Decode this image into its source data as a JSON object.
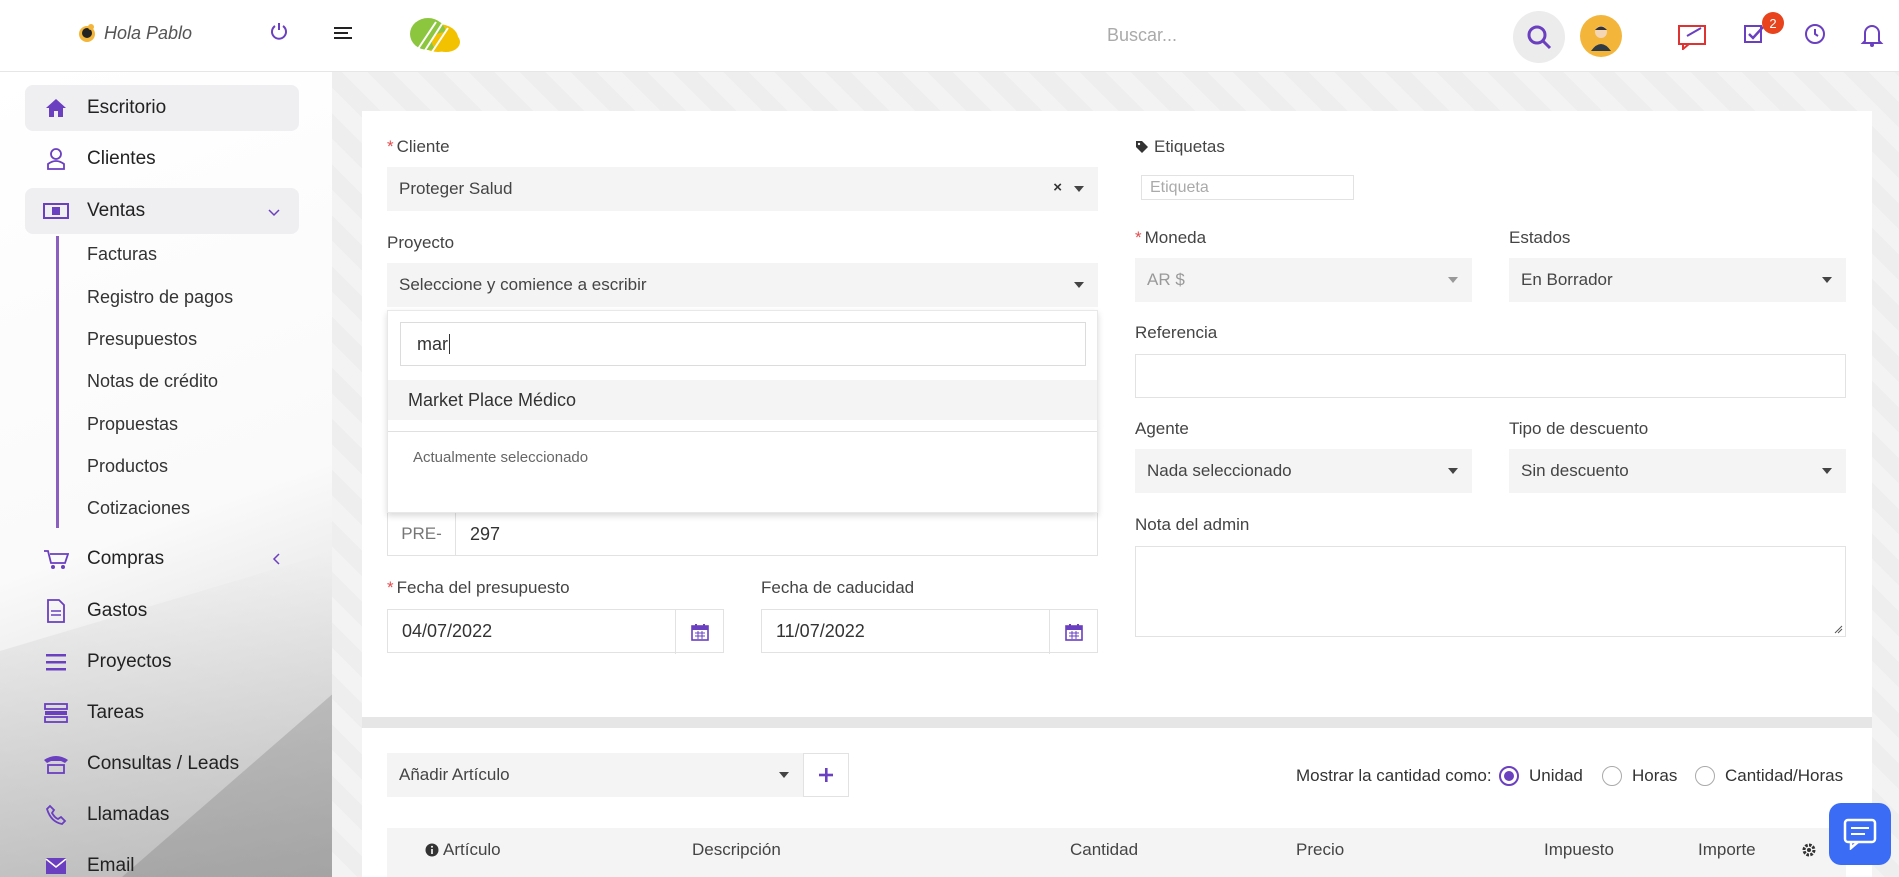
{
  "header": {
    "greeting": "Hola Pablo",
    "search_placeholder": "Buscar...",
    "tasks_badge": "2"
  },
  "sidebar": {
    "items": [
      {
        "label": "Escritorio"
      },
      {
        "label": "Clientes"
      },
      {
        "label": "Ventas"
      },
      {
        "label": "Compras"
      },
      {
        "label": "Gastos"
      },
      {
        "label": "Proyectos"
      },
      {
        "label": "Tareas"
      },
      {
        "label": "Consultas / Leads"
      },
      {
        "label": "Llamadas"
      },
      {
        "label": "Email"
      }
    ],
    "ventas_sub": [
      "Facturas",
      "Registro de pagos",
      "Presupuestos",
      "Notas de crédito",
      "Propuestas",
      "Productos",
      "Cotizaciones"
    ]
  },
  "form": {
    "cliente_label": "Cliente",
    "cliente_value": "Proteger Salud",
    "proyecto_label": "Proyecto",
    "proyecto_value": "Seleccione y comience a escribir",
    "dropdown": {
      "search_value": "mar",
      "option": "Market Place Médico",
      "selected_header": "Actualmente seleccionado"
    },
    "numero_prefix": "PRE-",
    "numero_value": "297",
    "fecha_label": "Fecha del presupuesto",
    "fecha_value": "04/07/2022",
    "caducidad_label": "Fecha de caducidad",
    "caducidad_value": "11/07/2022",
    "etiquetas_label": "Etiquetas",
    "etiqueta_placeholder": "Etiqueta",
    "moneda_label": "Moneda",
    "moneda_value": "AR $",
    "estados_label": "Estados",
    "estados_value": "En Borrador",
    "referencia_label": "Referencia",
    "agente_label": "Agente",
    "agente_value": "Nada seleccionado",
    "descuento_label": "Tipo de descuento",
    "descuento_value": "Sin descuento",
    "nota_label": "Nota del admin"
  },
  "items": {
    "add_item": "Añadir Artículo",
    "qty_label": "Mostrar la cantidad como:",
    "qty_options": [
      "Unidad",
      "Horas",
      "Cantidad/Horas"
    ],
    "columns": [
      "Artículo",
      "Descripción",
      "Cantidad",
      "Precio",
      "Impuesto",
      "Importe"
    ]
  },
  "colors": {
    "accent": "#6a3fc0",
    "badge": "#e8431c",
    "chat": "#3b6cf6"
  }
}
